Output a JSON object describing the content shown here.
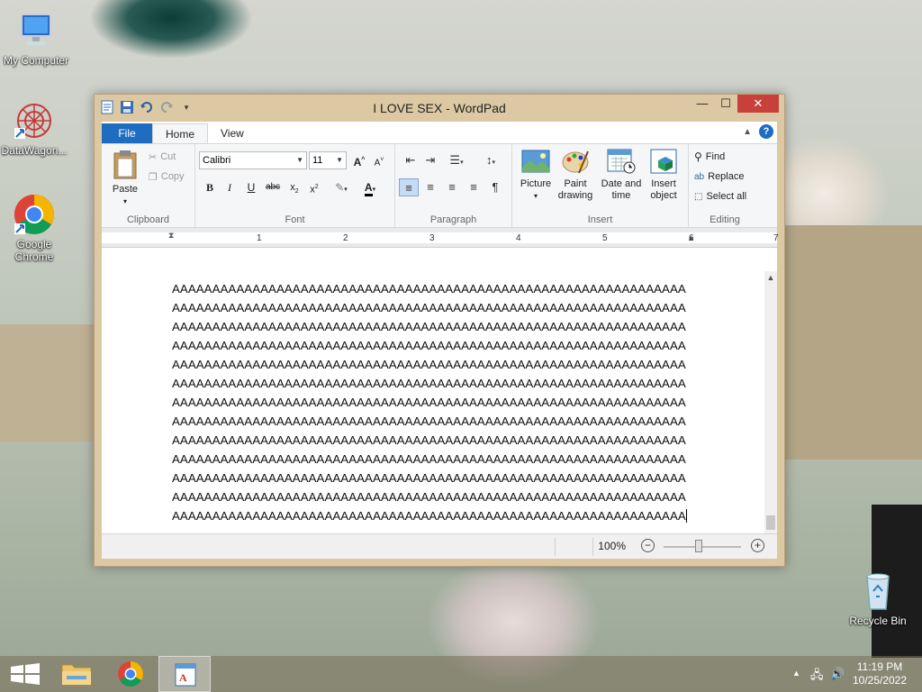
{
  "desktop": {
    "icons": [
      {
        "label": "My Computer",
        "icon": "computer-icon"
      },
      {
        "label": "DataWagon...",
        "icon": "datawagon-icon"
      },
      {
        "label": "Google Chrome",
        "icon": "chrome-icon"
      },
      {
        "label": "Recycle Bin",
        "icon": "recycle-bin-icon"
      }
    ]
  },
  "window": {
    "title": "I LOVE SEX - WordPad",
    "controls": {
      "minimize": "—",
      "maximize": "☐",
      "close": "✕"
    }
  },
  "ribbon": {
    "tabs": [
      "File",
      "Home",
      "View"
    ],
    "clipboard": {
      "label": "Clipboard",
      "paste": "Paste",
      "cut": "Cut",
      "copy": "Copy"
    },
    "font": {
      "label": "Font",
      "family": "Calibri",
      "size": "11"
    },
    "paragraph": {
      "label": "Paragraph"
    },
    "insert": {
      "label": "Insert",
      "picture": "Picture",
      "paint_drawing": "Paint drawing",
      "date_time": "Date and time",
      "insert_object": "Insert object"
    },
    "editing": {
      "label": "Editing",
      "find": "Find",
      "replace": "Replace",
      "select_all": "Select all"
    }
  },
  "ruler": {
    "numbers": [
      "1",
      "2",
      "3",
      "4",
      "5",
      "6",
      "7"
    ]
  },
  "document": {
    "lines": [
      "AAAAAAAAAAAAAAAAAAAAAAAAAAAAAAAAAAAAAAAAAAAAAAAAAAAAAAAAAAAAAAAA",
      "AAAAAAAAAAAAAAAAAAAAAAAAAAAAAAAAAAAAAAAAAAAAAAAAAAAAAAAAAAAAAAAA",
      "AAAAAAAAAAAAAAAAAAAAAAAAAAAAAAAAAAAAAAAAAAAAAAAAAAAAAAAAAAAAAAAA",
      "AAAAAAAAAAAAAAAAAAAAAAAAAAAAAAAAAAAAAAAAAAAAAAAAAAAAAAAAAAAAAAAA",
      "AAAAAAAAAAAAAAAAAAAAAAAAAAAAAAAAAAAAAAAAAAAAAAAAAAAAAAAAAAAAAAAA",
      "AAAAAAAAAAAAAAAAAAAAAAAAAAAAAAAAAAAAAAAAAAAAAAAAAAAAAAAAAAAAAAAA",
      "AAAAAAAAAAAAAAAAAAAAAAAAAAAAAAAAAAAAAAAAAAAAAAAAAAAAAAAAAAAAAAAA",
      "AAAAAAAAAAAAAAAAAAAAAAAAAAAAAAAAAAAAAAAAAAAAAAAAAAAAAAAAAAAAAAAA",
      "AAAAAAAAAAAAAAAAAAAAAAAAAAAAAAAAAAAAAAAAAAAAAAAAAAAAAAAAAAAAAAAA",
      "AAAAAAAAAAAAAAAAAAAAAAAAAAAAAAAAAAAAAAAAAAAAAAAAAAAAAAAAAAAAAAAA",
      "AAAAAAAAAAAAAAAAAAAAAAAAAAAAAAAAAAAAAAAAAAAAAAAAAAAAAAAAAAAAAAAA",
      "AAAAAAAAAAAAAAAAAAAAAAAAAAAAAAAAAAAAAAAAAAAAAAAAAAAAAAAAAAAAAAAA",
      "AAAAAAAAAAAAAAAAAAAAAAAAAAAAAAAAAAAAAAAAAAAAAAAAAAAAAAAAAAAAAAAA"
    ]
  },
  "status": {
    "zoom": "100%"
  },
  "taskbar": {
    "time": "11:19 PM",
    "date": "10/25/2022"
  },
  "colors": {
    "file_tab": "#1e6dc1",
    "close_button": "#c7413a",
    "window_frame": "#dcc9a3"
  }
}
